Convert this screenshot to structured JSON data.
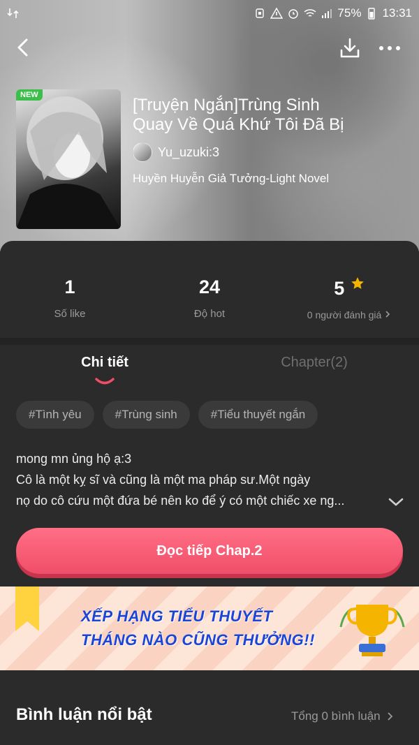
{
  "status_bar": {
    "battery": "75%",
    "time": "13:31"
  },
  "book": {
    "badge": "NEW",
    "title_line1": "[Truyện Ngắn]Trùng Sinh",
    "title_line2": "Quay Về Quá Khứ Tôi Đã Bị",
    "author": "Yu_uzuki:3",
    "genre": "Huyền Huyễn Giả Tưởng-Light Novel"
  },
  "stats": {
    "likes_value": "1",
    "likes_label": "Số like",
    "hot_value": "24",
    "hot_label": "Độ hot",
    "rating_value": "5",
    "rating_label": "0 người đánh giá"
  },
  "tabs": {
    "details": "Chi tiết",
    "chapter": "Chapter(2)"
  },
  "tags": [
    "#Tình yêu",
    "#Trùng sinh",
    "#Tiểu thuyết ngắn"
  ],
  "description": [
    "mong mn ủng hộ ạ:3",
    "Cô là một kỵ sĩ và cũng là một ma pháp sư.Một ngày",
    "nọ do cô cứu một đứa bé nên ko để ý có một chiếc xe ng..."
  ],
  "read_button": "Đọc tiếp Chap.2",
  "banner": {
    "line1": "XẾP HẠNG TIỂU THUYẾT",
    "line2": "THÁNG NÀO CŨNG THƯỞNG!!"
  },
  "comments": {
    "title": "Bình luận nổi bật",
    "count": "Tổng 0 bình luận"
  },
  "colors": {
    "accent": "#f04e68",
    "star": "#f5b400",
    "banner_text": "#1b45d6",
    "panel": "#2b2b2b"
  },
  "icons": [
    "back-icon",
    "download-icon",
    "more-icon",
    "star-icon",
    "chevron-down-icon",
    "chevron-right-icon",
    "trophy-icon",
    "ribbon-icon"
  ]
}
